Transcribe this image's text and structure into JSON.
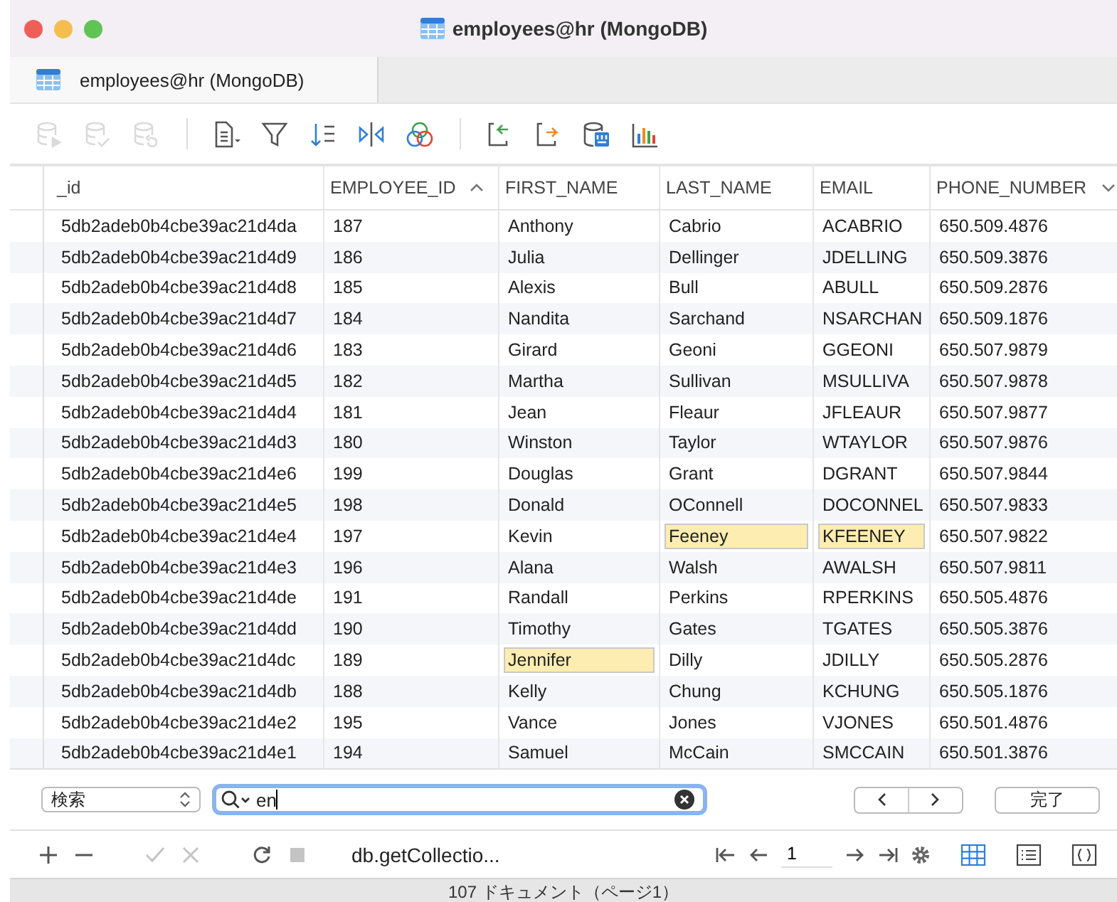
{
  "window": {
    "title": "employees@hr (MongoDB)"
  },
  "tabs": [
    {
      "label": "employees@hr (MongoDB)",
      "selected": true
    }
  ],
  "toolbar": [
    {
      "kind": "db-run",
      "disabled": true
    },
    {
      "kind": "db-check",
      "disabled": true
    },
    {
      "kind": "db-undo",
      "disabled": true
    },
    {
      "kind": "sep"
    },
    {
      "kind": "doc",
      "disabled": false
    },
    {
      "kind": "filter",
      "disabled": false
    },
    {
      "kind": "sort",
      "disabled": false
    },
    {
      "kind": "split",
      "disabled": false
    },
    {
      "kind": "circles",
      "disabled": false
    },
    {
      "kind": "sep"
    },
    {
      "kind": "import",
      "disabled": false
    },
    {
      "kind": "export",
      "disabled": false
    },
    {
      "kind": "db-binary",
      "disabled": false
    },
    {
      "kind": "chart",
      "disabled": false
    }
  ],
  "table": {
    "columns": [
      {
        "label": "_id",
        "sorted": false,
        "menu": false
      },
      {
        "label": "EMPLOYEE_ID",
        "sorted": true,
        "menu": false
      },
      {
        "label": "FIRST_NAME",
        "sorted": false,
        "menu": false
      },
      {
        "label": "LAST_NAME",
        "sorted": false,
        "menu": false
      },
      {
        "label": "EMAIL",
        "sorted": false,
        "menu": false
      },
      {
        "label": "PHONE_NUMBER",
        "sorted": false,
        "menu": true
      }
    ],
    "rows": [
      {
        "cells": [
          {
            "text": "5db2adeb0b4cbe39ac21d4da",
            "hit": false
          },
          {
            "text": "187",
            "hit": false
          },
          {
            "text": "Anthony",
            "hit": false
          },
          {
            "text": "Cabrio",
            "hit": false
          },
          {
            "text": "ACABRIO",
            "hit": false
          },
          {
            "text": "650.509.4876",
            "hit": false
          }
        ]
      },
      {
        "cells": [
          {
            "text": "5db2adeb0b4cbe39ac21d4d9",
            "hit": false
          },
          {
            "text": "186",
            "hit": false
          },
          {
            "text": "Julia",
            "hit": false
          },
          {
            "text": "Dellinger",
            "hit": false
          },
          {
            "text": "JDELLING",
            "hit": false
          },
          {
            "text": "650.509.3876",
            "hit": false
          }
        ]
      },
      {
        "cells": [
          {
            "text": "5db2adeb0b4cbe39ac21d4d8",
            "hit": false
          },
          {
            "text": "185",
            "hit": false
          },
          {
            "text": "Alexis",
            "hit": false
          },
          {
            "text": "Bull",
            "hit": false
          },
          {
            "text": "ABULL",
            "hit": false
          },
          {
            "text": "650.509.2876",
            "hit": false
          }
        ]
      },
      {
        "cells": [
          {
            "text": "5db2adeb0b4cbe39ac21d4d7",
            "hit": false
          },
          {
            "text": "184",
            "hit": false
          },
          {
            "text": "Nandita",
            "hit": false
          },
          {
            "text": "Sarchand",
            "hit": false
          },
          {
            "text": "NSARCHAN",
            "hit": false
          },
          {
            "text": "650.509.1876",
            "hit": false
          }
        ]
      },
      {
        "cells": [
          {
            "text": "5db2adeb0b4cbe39ac21d4d6",
            "hit": false
          },
          {
            "text": "183",
            "hit": false
          },
          {
            "text": "Girard",
            "hit": false
          },
          {
            "text": "Geoni",
            "hit": false
          },
          {
            "text": "GGEONI",
            "hit": false
          },
          {
            "text": "650.507.9879",
            "hit": false
          }
        ]
      },
      {
        "cells": [
          {
            "text": "5db2adeb0b4cbe39ac21d4d5",
            "hit": false
          },
          {
            "text": "182",
            "hit": false
          },
          {
            "text": "Martha",
            "hit": false
          },
          {
            "text": "Sullivan",
            "hit": false
          },
          {
            "text": "MSULLIVA",
            "hit": false
          },
          {
            "text": "650.507.9878",
            "hit": false
          }
        ]
      },
      {
        "cells": [
          {
            "text": "5db2adeb0b4cbe39ac21d4d4",
            "hit": false
          },
          {
            "text": "181",
            "hit": false
          },
          {
            "text": "Jean",
            "hit": false
          },
          {
            "text": "Fleaur",
            "hit": false
          },
          {
            "text": "JFLEAUR",
            "hit": false
          },
          {
            "text": "650.507.9877",
            "hit": false
          }
        ]
      },
      {
        "cells": [
          {
            "text": "5db2adeb0b4cbe39ac21d4d3",
            "hit": false
          },
          {
            "text": "180",
            "hit": false
          },
          {
            "text": "Winston",
            "hit": false
          },
          {
            "text": "Taylor",
            "hit": false
          },
          {
            "text": "WTAYLOR",
            "hit": false
          },
          {
            "text": "650.507.9876",
            "hit": false
          }
        ]
      },
      {
        "cells": [
          {
            "text": "5db2adeb0b4cbe39ac21d4e6",
            "hit": false
          },
          {
            "text": "199",
            "hit": false
          },
          {
            "text": "Douglas",
            "hit": false
          },
          {
            "text": "Grant",
            "hit": false
          },
          {
            "text": "DGRANT",
            "hit": false
          },
          {
            "text": "650.507.9844",
            "hit": false
          }
        ]
      },
      {
        "cells": [
          {
            "text": "5db2adeb0b4cbe39ac21d4e5",
            "hit": false
          },
          {
            "text": "198",
            "hit": false
          },
          {
            "text": "Donald",
            "hit": false
          },
          {
            "text": "OConnell",
            "hit": false
          },
          {
            "text": "DOCONNEL",
            "hit": false
          },
          {
            "text": "650.507.9833",
            "hit": false
          }
        ]
      },
      {
        "cells": [
          {
            "text": "5db2adeb0b4cbe39ac21d4e4",
            "hit": false
          },
          {
            "text": "197",
            "hit": false
          },
          {
            "text": "Kevin",
            "hit": false
          },
          {
            "text": "Feeney",
            "hit": true
          },
          {
            "text": "KFEENEY",
            "hit": true
          },
          {
            "text": "650.507.9822",
            "hit": false
          }
        ]
      },
      {
        "cells": [
          {
            "text": "5db2adeb0b4cbe39ac21d4e3",
            "hit": false
          },
          {
            "text": "196",
            "hit": false
          },
          {
            "text": "Alana",
            "hit": false
          },
          {
            "text": "Walsh",
            "hit": false
          },
          {
            "text": "AWALSH",
            "hit": false
          },
          {
            "text": "650.507.9811",
            "hit": false
          }
        ]
      },
      {
        "cells": [
          {
            "text": "5db2adeb0b4cbe39ac21d4de",
            "hit": false
          },
          {
            "text": "191",
            "hit": false
          },
          {
            "text": "Randall",
            "hit": false
          },
          {
            "text": "Perkins",
            "hit": false
          },
          {
            "text": "RPERKINS",
            "hit": false
          },
          {
            "text": "650.505.4876",
            "hit": false
          }
        ]
      },
      {
        "cells": [
          {
            "text": "5db2adeb0b4cbe39ac21d4dd",
            "hit": false
          },
          {
            "text": "190",
            "hit": false
          },
          {
            "text": "Timothy",
            "hit": false
          },
          {
            "text": "Gates",
            "hit": false
          },
          {
            "text": "TGATES",
            "hit": false
          },
          {
            "text": "650.505.3876",
            "hit": false
          }
        ]
      },
      {
        "cells": [
          {
            "text": "5db2adeb0b4cbe39ac21d4dc",
            "hit": false
          },
          {
            "text": "189",
            "hit": false
          },
          {
            "text": "Jennifer",
            "hit": true
          },
          {
            "text": "Dilly",
            "hit": false
          },
          {
            "text": "JDILLY",
            "hit": false
          },
          {
            "text": "650.505.2876",
            "hit": false
          }
        ]
      },
      {
        "cells": [
          {
            "text": "5db2adeb0b4cbe39ac21d4db",
            "hit": false
          },
          {
            "text": "188",
            "hit": false
          },
          {
            "text": "Kelly",
            "hit": false
          },
          {
            "text": "Chung",
            "hit": false
          },
          {
            "text": "KCHUNG",
            "hit": false
          },
          {
            "text": "650.505.1876",
            "hit": false
          }
        ]
      },
      {
        "cells": [
          {
            "text": "5db2adeb0b4cbe39ac21d4e2",
            "hit": false
          },
          {
            "text": "195",
            "hit": false
          },
          {
            "text": "Vance",
            "hit": false
          },
          {
            "text": "Jones",
            "hit": false
          },
          {
            "text": "VJONES",
            "hit": false
          },
          {
            "text": "650.501.4876",
            "hit": false
          }
        ]
      },
      {
        "cells": [
          {
            "text": "5db2adeb0b4cbe39ac21d4e1",
            "hit": false
          },
          {
            "text": "194",
            "hit": false
          },
          {
            "text": "Samuel",
            "hit": false
          },
          {
            "text": "McCain",
            "hit": false
          },
          {
            "text": "SMCCAIN",
            "hit": false
          },
          {
            "text": "650.501.3876",
            "hit": false
          }
        ]
      }
    ]
  },
  "search": {
    "scope": "検索",
    "value": "en",
    "done": "完了"
  },
  "bottom_bar": {
    "actions": [
      {
        "kind": "add",
        "disabled": false
      },
      {
        "kind": "remove",
        "disabled": false
      },
      {
        "kind": "sep"
      },
      {
        "kind": "apply",
        "disabled": true
      },
      {
        "kind": "discard",
        "disabled": true
      },
      {
        "kind": "sep"
      },
      {
        "kind": "refresh",
        "disabled": false
      },
      {
        "kind": "stop",
        "disabled": true
      }
    ],
    "query": "db.getCollectio...",
    "page": "1",
    "views": [
      {
        "kind": "grid",
        "selected": true
      },
      {
        "kind": "list",
        "selected": false
      },
      {
        "kind": "json",
        "selected": false
      }
    ]
  },
  "status_bar": "107 ドキュメント（ページ1）"
}
